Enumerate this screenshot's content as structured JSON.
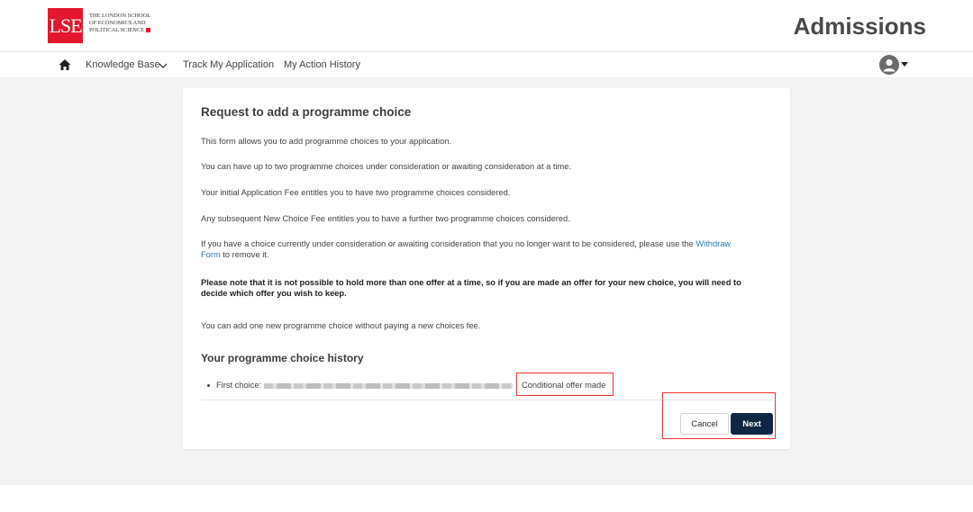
{
  "header": {
    "logo_mark": "LSE",
    "logo_lines": [
      "THE LONDON SCHOOL",
      "OF ECONOMICS AND",
      "POLITICAL SCIENCE"
    ],
    "title": "Admissions",
    "brand_color": "#e3172d"
  },
  "nav": {
    "home_icon": "home-icon",
    "items": [
      {
        "label": "Knowledge Base",
        "has_dropdown": true
      },
      {
        "label": "Track My Application"
      },
      {
        "label": "My Action History"
      }
    ],
    "user_icon": "user-avatar-icon"
  },
  "form": {
    "title": "Request to add a programme choice",
    "paragraphs": [
      "This form allows you to add programme choices to your application.",
      "You can have up to two programme choices under consideration or awaiting consideration at a time.",
      "Your initial Application Fee entitles you to have two programme choices considered.",
      "Any subsequent New Choice Fee entitles you to have a further two programme choices considered."
    ],
    "withdraw_before": "If you have a choice currently under consideration or awaiting consideration that you no longer want to be considered, please use the ",
    "withdraw_link": "Withdraw",
    "withdraw_link_2": "Form",
    "withdraw_after": " to remove it.",
    "warning": "Please note that it is not possible to hold more than one offer at a time, so if you are made an offer for your new choice, you will need to decide which offer you wish to keep.",
    "fee_note": "You can add one new programme choice without paying a new choices fee."
  },
  "history": {
    "title": "Your programme choice history",
    "items": [
      {
        "label": "First choice:",
        "status": "Conditional offer made"
      }
    ]
  },
  "buttons": {
    "cancel": "Cancel",
    "next": "Next",
    "next_color": "#0f2745"
  },
  "highlight_color": "#e33333"
}
